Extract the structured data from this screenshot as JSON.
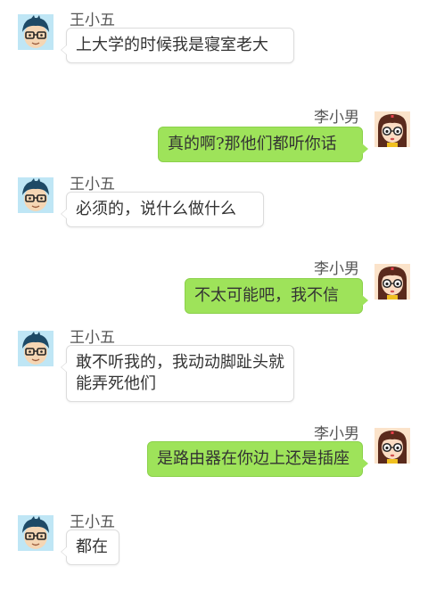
{
  "participants": {
    "left": {
      "name": "王小五",
      "avatar_icon": "boy-glasses-avatar-icon"
    },
    "right": {
      "name": "李小男",
      "avatar_icon": "girl-glasses-avatar-icon"
    }
  },
  "colors": {
    "sent_bubble": "#9ee35a",
    "received_bubble": "#ffffff",
    "name_text": "#555555",
    "message_text": "#333333"
  },
  "messages": [
    {
      "sender": "王小五",
      "side": "left",
      "text": "上大学的时候我是寝室老大"
    },
    {
      "sender": "李小男",
      "side": "right",
      "text": "真的啊?那他们都听你话"
    },
    {
      "sender": "王小五",
      "side": "left",
      "text": "必须的，说什么做什么"
    },
    {
      "sender": "李小男",
      "side": "right",
      "text": "不太可能吧，我不信"
    },
    {
      "sender": "王小五",
      "side": "left",
      "text": "敢不听我的，我动动脚趾头就能弄死他们"
    },
    {
      "sender": "李小男",
      "side": "right",
      "text": "是路由器在你边上还是插座"
    },
    {
      "sender": "王小五",
      "side": "left",
      "text": "都在"
    }
  ]
}
